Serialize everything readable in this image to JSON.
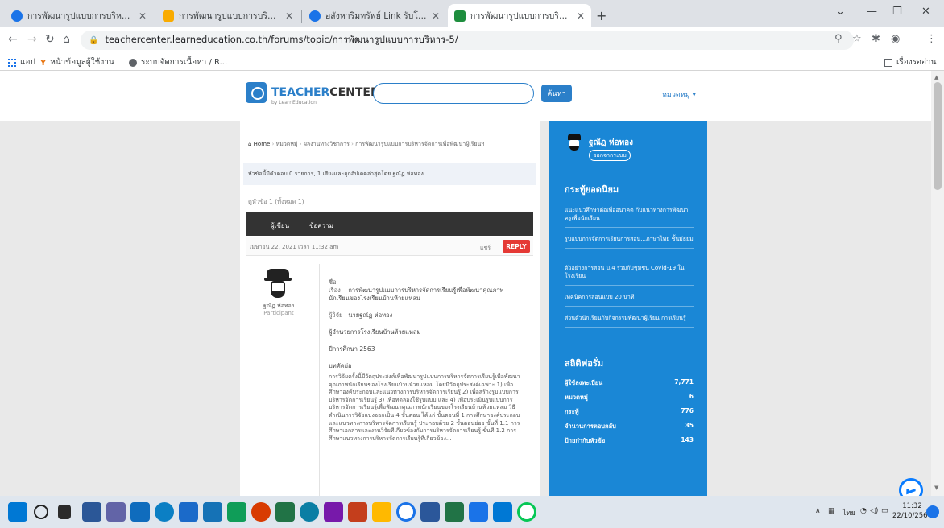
{
  "browser": {
    "tabs": [
      {
        "title": "การพัฒนารูปแบบการบริหารจัดการเพื่อ...",
        "favicon_color": "#1a73e8"
      },
      {
        "title": "การพัฒนารูปแบบการบริหารจัดการเพื่อ...",
        "favicon_color": "#f9ab00"
      },
      {
        "title": "อสังหาริมทรัพย์ Link รับโพสต์ฟรีเลยนี้",
        "favicon_color": "#1a73e8"
      },
      {
        "title": "การพัฒนารูปแบบการบริหารจัดการเพื่อ...",
        "favicon_color": "#1e8e3e"
      }
    ],
    "url": "teachercenter.learneducation.co.th/forums/topic/การพัฒนารูปแบบการบริหาร-5/",
    "bookmarks": [
      {
        "label": "แอป",
        "icon": "apps-grid-icon"
      },
      {
        "label": "หน้าข้อมูลผู้ใช้งาน",
        "icon": "y-icon"
      },
      {
        "label": "ระบบจัดการเนื้อหา / R...",
        "icon": "globe-icon"
      }
    ],
    "reading_list": "เรื่องรออ่าน"
  },
  "site": {
    "logo_left": "TEACHER",
    "logo_right": "CENTER",
    "logo_sub": "by LearnEducation",
    "search_button": "ค้นหา",
    "user_menu": "หมวดหมู่ ▾"
  },
  "topic": {
    "breadcrumb_home": "Home",
    "breadcrumb_1": "หมวดหมู่",
    "breadcrumb_2": "ผลงานทางวิชาการ",
    "breadcrumb_3": "การพัฒนารูปแบบการบริหารจัดการเพื่อพัฒนาผู้เรียนฯ",
    "notice": "หัวข้อนี้มีคำตอบ 0 รายการ, 1 เสียงและถูกอัปเดตล่าสุดโดย ฐณัฏ ห่อทอง",
    "pager": "ดูหัวข้อ 1 (ทั้งหมด 1)",
    "col_author": "ผู้เขียน",
    "col_post": "ข้อความ",
    "post_date": "เมษายน 22, 2021 เวลา 11:32 am",
    "share": "แชร์",
    "reply": "REPLY",
    "author_name": "ฐณัฏ ห่อทอง",
    "author_role": "Participant",
    "title_label": "ชื่อเรื่อง",
    "title_value": "การพัฒนารูปแบบการบริหารจัดการเรียนรู้เพื่อพัฒนาคุณภาพนักเรียนของโรงเรียนบ้านห้วยแหลม",
    "researcher_label": "ผู้วิจัย",
    "researcher_value": "นายฐณัฏ ห่อทอง",
    "school_value": "ผู้อำนวยการโรงเรียนบ้านห้วยแหลม",
    "year_label": "ปีการศึกษา",
    "year_value": "2563",
    "abstract_label": "บทคัดย่อ",
    "abstract": "การวิจัยครั้งนี้มีวัตถุประสงค์เพื่อพัฒนารูปแบบการบริหารจัดการเรียนรู้เพื่อพัฒนาคุณภาพนักเรียนของโรงเรียนบ้านห้วยแหลม โดยมีวัตถุประสงค์เฉพาะ 1) เพื่อศึกษาองค์ประกอบและแนวทางการบริหารจัดการเรียนรู้ 2) เพื่อสร้างรูปแบบการบริหารจัดการเรียนรู้ 3) เพื่อทดลองใช้รูปแบบ และ 4) เพื่อประเมินรูปแบบการบริหารจัดการเรียนรู้เพื่อพัฒนาคุณภาพนักเรียนของโรงเรียนบ้านห้วยแหลม วิธีดำเนินการวิจัยแบ่งออกเป็น 4 ขั้นตอน ได้แก่ ขั้นตอนที่ 1 การศึกษาองค์ประกอบและแนวทางการบริหารจัดการเรียนรู้ ประกอบด้วย 2 ขั้นตอนย่อย ขั้นที่ 1.1 การศึกษาเอกสารและงานวิจัยที่เกี่ยวข้องกับการบริหารจัดการเรียนรู้ ขั้นที่ 1.2 การศึกษาแนวทางการบริหารจัดการเรียนรู้ที่เกี่ยวข้อง..."
  },
  "sidebar": {
    "user_name": "ฐณัฏ ห่อทอง",
    "logout": "ออกจากระบบ",
    "popular_heading": "กระทู้ยอดนิยม",
    "popular": [
      "แนะแนวศึกษาต่อเพื่ออนาคต กับแนวทางการพัฒนาครูเพื่อนักเรียน",
      "รูปแบบการจัดการเรียนการสอน...ภาษาไทย ชั้นมัธยม",
      "ตัวอย่างการสอน ป.4 ร่วมกับชุมชน Covid-19 ในโรงเรียน",
      "เทคนิคการสอนแบบ 20 นาที",
      "ส่วนตัวนักเรียนกับกิจกรรมพัฒนาผู้เรียน การเรียนรู้"
    ],
    "stats_heading": "สถิติฟอรั่ม",
    "stats": [
      {
        "label": "ผู้ใช้ลงทะเบียน",
        "value": "7,771"
      },
      {
        "label": "หมวดหมู่",
        "value": "6"
      },
      {
        "label": "กระทู้",
        "value": "776"
      },
      {
        "label": "จำนวนการตอบกลับ",
        "value": "35"
      },
      {
        "label": "ป้ายกำกับหัวข้อ",
        "value": "143"
      }
    ]
  },
  "taskbar": {
    "lang": "ไทย",
    "time": "11:32",
    "date": "22/10/2564"
  }
}
